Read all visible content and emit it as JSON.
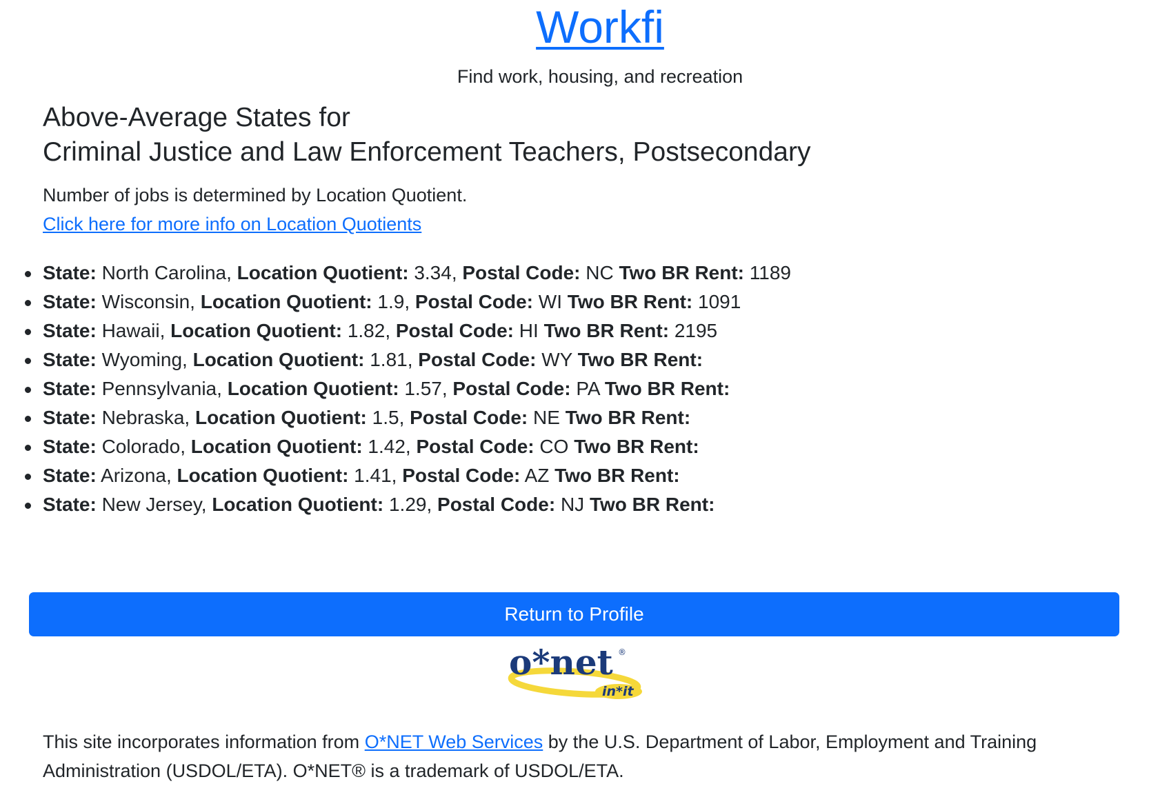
{
  "brand": {
    "name": "Workfi",
    "tagline": "Find work, housing, and recreation"
  },
  "page": {
    "title_line1": "Above-Average States for",
    "title_line2": "Criminal Justice and Law Enforcement Teachers, Postsecondary",
    "intro_text": "Number of jobs is determined by Location Quotient.",
    "info_link": "Click here for more info on Location Quotients"
  },
  "labels": {
    "state": "State:",
    "lq": "Location Quotient:",
    "postal": "Postal Code:",
    "rent": "Two BR Rent:"
  },
  "states": [
    {
      "state": "North Carolina",
      "lq": "3.34",
      "postal": "NC",
      "rent": "1189"
    },
    {
      "state": "Wisconsin",
      "lq": "1.9",
      "postal": "WI",
      "rent": "1091"
    },
    {
      "state": "Hawaii",
      "lq": "1.82",
      "postal": "HI",
      "rent": "2195"
    },
    {
      "state": "Wyoming",
      "lq": "1.81",
      "postal": "WY",
      "rent": ""
    },
    {
      "state": "Pennsylvania",
      "lq": "1.57",
      "postal": "PA",
      "rent": ""
    },
    {
      "state": "Nebraska",
      "lq": "1.5",
      "postal": "NE",
      "rent": ""
    },
    {
      "state": "Colorado",
      "lq": "1.42",
      "postal": "CO",
      "rent": ""
    },
    {
      "state": "Arizona",
      "lq": "1.41",
      "postal": "AZ",
      "rent": ""
    },
    {
      "state": "New Jersey",
      "lq": "1.29",
      "postal": "NJ",
      "rent": ""
    }
  ],
  "return_button": "Return to Profile",
  "logo": {
    "main_text": "o*net",
    "sub_text": "in*it"
  },
  "footer": {
    "text_before": "This site incorporates information from ",
    "link": "O*NET Web Services",
    "text_after": " by the U.S. Department of Labor, Employment and Training Administration (USDOL/ETA). O*NET® is a trademark of USDOL/ETA."
  },
  "colors": {
    "primary": "#0d6efd",
    "text": "#212529",
    "logo_navy": "#1b3a7a",
    "logo_yellow": "#f5d83a"
  }
}
